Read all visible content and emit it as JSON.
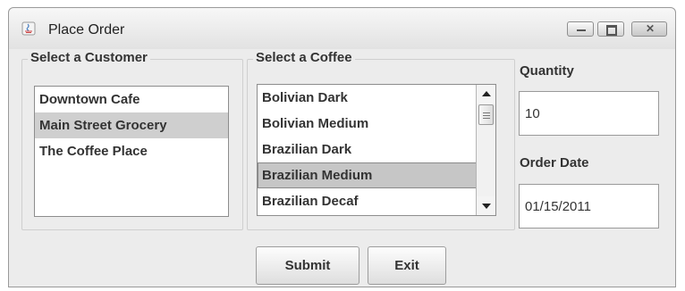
{
  "window": {
    "title": "Place Order",
    "controls": [
      "minimize",
      "maximize",
      "close"
    ]
  },
  "customer_panel": {
    "legend": "Select a Customer",
    "items": [
      "Downtown Cafe",
      "Main Street Grocery",
      "The Coffee Place"
    ],
    "selected": "Main Street Grocery"
  },
  "coffee_panel": {
    "legend": "Select a Coffee",
    "items": [
      "Bolivian Dark",
      "Bolivian Medium",
      "Brazilian Dark",
      "Brazilian Medium",
      "Brazilian Decaf"
    ],
    "selected": "Brazilian Medium"
  },
  "quantity": {
    "label": "Quantity",
    "value": "10"
  },
  "order_date": {
    "label": "Order Date",
    "value": "01/15/2011"
  },
  "buttons": {
    "submit": "Submit",
    "exit": "Exit"
  },
  "colors": {
    "window_bg": "#ececec",
    "selection": "#cfcfcf",
    "text": "#333333"
  }
}
